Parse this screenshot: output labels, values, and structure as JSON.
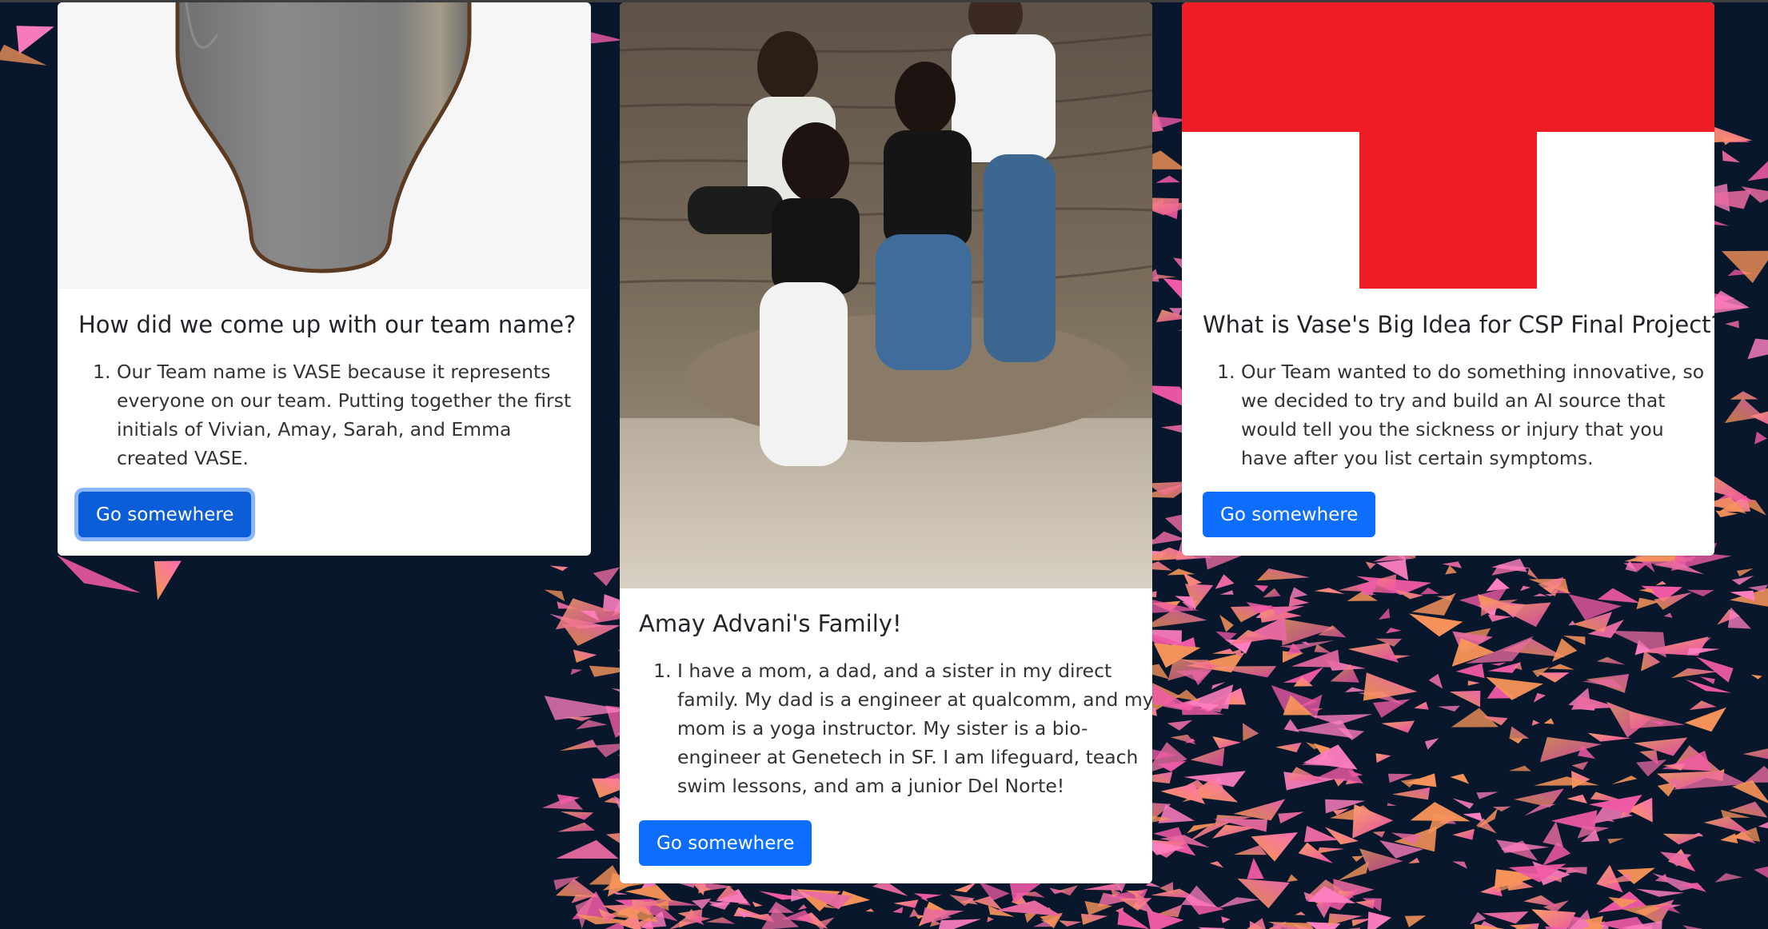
{
  "colors": {
    "background": "#08172c",
    "button": "#0d6efd",
    "button_focus_ring": "#8bb6fb",
    "red_cross": "#ee1c25",
    "shard_pink": "#f05aa6",
    "shard_orange": "#f7945a"
  },
  "cards": [
    {
      "image": "vase-illustration",
      "title": "How did we come up with our team name?",
      "items": [
        "Our Team name is VASE because it represents everyone on our team. Putting together the first initials of Vivian, Amay, Sarah, and Emma created VASE."
      ],
      "button": "Go somewhere"
    },
    {
      "image": "family-photo",
      "title": "Amay Advani's Family!",
      "items": [
        "I have a mom, a dad, and a sister in my direct family. My dad is a engineer at qualcomm, and my mom is a yoga instructor. My sister is a bio-engineer at Genetech in SF. I am lifeguard, teach swim lessons, and am a junior Del Norte!"
      ],
      "button": "Go somewhere"
    },
    {
      "image": "red-cross-logo",
      "title": "What is Vase's Big Idea for CSP Final Project?",
      "items": [
        "Our Team wanted to do something innovative, so we decided to try and build an AI source that would tell you the sickness or injury that you have after you list certain symptoms."
      ],
      "button": "Go somewhere"
    }
  ]
}
